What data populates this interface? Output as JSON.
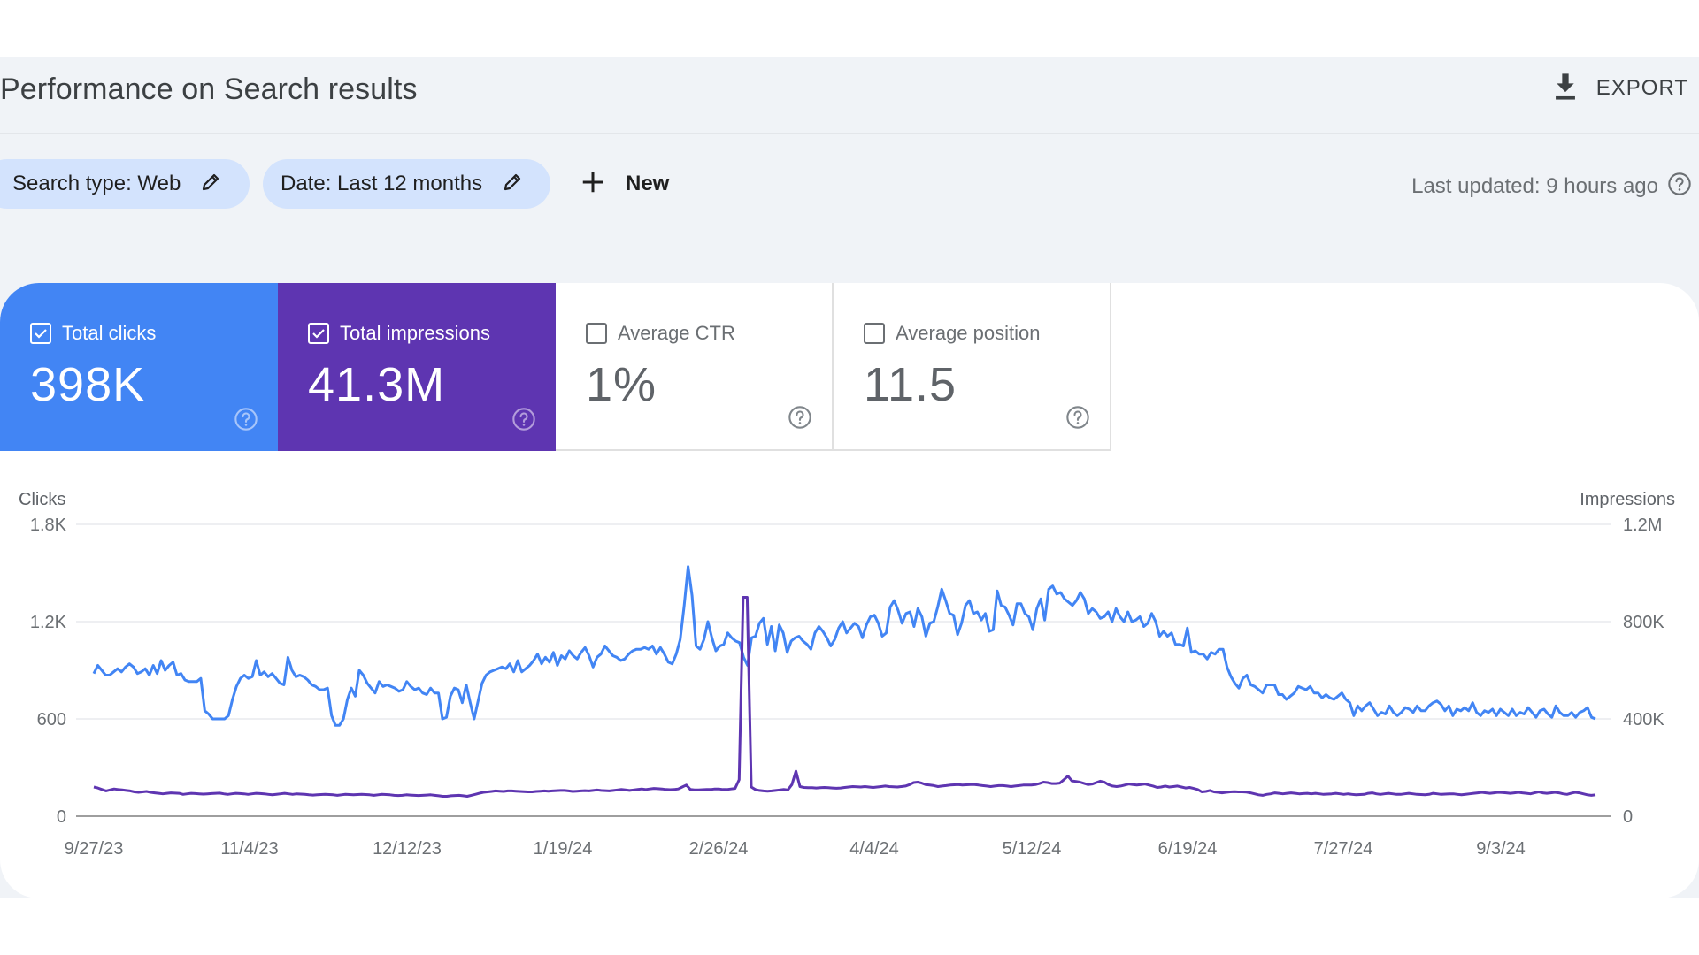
{
  "header": {
    "title": "Performance on Search results",
    "export_label": "EXPORT"
  },
  "filters": {
    "search_type": "Search type: Web",
    "date": "Date: Last 12 months",
    "new_label": "New",
    "last_updated": "Last updated: 9 hours ago"
  },
  "metrics": [
    {
      "label": "Total clicks",
      "value": "398K",
      "checked": true,
      "color": "#4285f4"
    },
    {
      "label": "Total impressions",
      "value": "41.3M",
      "checked": true,
      "color": "#5e35b1"
    },
    {
      "label": "Average CTR",
      "value": "1%",
      "checked": false
    },
    {
      "label": "Average position",
      "value": "11.5",
      "checked": false
    }
  ],
  "chart_data": {
    "type": "line",
    "title": "",
    "xlabel": "",
    "ylabel": "Clicks",
    "y2label": "Impressions",
    "ylim": [
      0,
      1800
    ],
    "y2lim": [
      0,
      1200000
    ],
    "yticks": [
      "0",
      "600",
      "1.2K",
      "1.8K"
    ],
    "y2ticks": [
      "0",
      "400K",
      "800K",
      "1.2M"
    ],
    "xtick_labels": [
      "9/27/23",
      "11/4/23",
      "12/12/23",
      "1/19/24",
      "2/26/24",
      "4/4/24",
      "5/12/24",
      "6/19/24",
      "7/27/24",
      "9/3/24"
    ],
    "grid": true,
    "legend": "none",
    "series": [
      {
        "name": "Clicks",
        "axis": "left",
        "color": "#4285f4",
        "values": [
          880,
          930,
          900,
          870,
          870,
          890,
          910,
          890,
          920,
          940,
          920,
          880,
          890,
          910,
          870,
          930,
          880,
          960,
          900,
          930,
          950,
          870,
          880,
          840,
          830,
          830,
          830,
          850,
          650,
          630,
          600,
          600,
          600,
          600,
          620,
          720,
          800,
          850,
          870,
          850,
          860,
          960,
          870,
          890,
          860,
          880,
          850,
          820,
          810,
          980,
          900,
          860,
          870,
          860,
          840,
          810,
          800,
          780,
          780,
          790,
          620,
          560,
          560,
          600,
          720,
          790,
          740,
          900,
          870,
          820,
          790,
          760,
          830,
          800,
          810,
          800,
          790,
          770,
          780,
          830,
          800,
          780,
          790,
          760,
          750,
          790,
          760,
          760,
          600,
          610,
          740,
          790,
          780,
          700,
          810,
          700,
          600,
          710,
          820,
          870,
          890,
          900,
          910,
          920,
          910,
          940,
          890,
          960,
          890,
          910,
          930,
          960,
          1000,
          940,
          980,
          950,
          1010,
          930,
          990,
          970,
          1020,
          990,
          970,
          1010,
          1040,
          990,
          920,
          980,
          1000,
          1050,
          1020,
          990,
          980,
          960,
          970,
          1000,
          1020,
          1030,
          1030,
          1040,
          1030,
          1050,
          1000,
          1040,
          1000,
          950,
          940,
          1000,
          1090,
          1300,
          1540,
          1360,
          1050,
          1030,
          1090,
          1200,
          1100,
          1020,
          1050,
          1060,
          1130,
          1100,
          1080,
          1070,
          980,
          930,
          1100,
          1110,
          1190,
          1220,
          1060,
          1170,
          1020,
          1180,
          1130,
          1010,
          1080,
          1100,
          1110,
          1080,
          1060,
          1030,
          1130,
          1170,
          1140,
          1100,
          1050,
          1090,
          1160,
          1200,
          1130,
          1160,
          1190,
          1170,
          1100,
          1180,
          1230,
          1240,
          1190,
          1110,
          1130,
          1290,
          1330,
          1270,
          1190,
          1250,
          1260,
          1170,
          1280,
          1230,
          1110,
          1190,
          1200,
          1290,
          1400,
          1330,
          1250,
          1240,
          1120,
          1190,
          1300,
          1330,
          1250,
          1260,
          1210,
          1250,
          1140,
          1150,
          1390,
          1300,
          1290,
          1240,
          1180,
          1310,
          1310,
          1250,
          1230,
          1150,
          1280,
          1340,
          1210,
          1400,
          1420,
          1370,
          1380,
          1340,
          1320,
          1300,
          1330,
          1380,
          1340,
          1250,
          1280,
          1260,
          1220,
          1230,
          1260,
          1200,
          1280,
          1230,
          1200,
          1260,
          1200,
          1210,
          1230,
          1170,
          1190,
          1250,
          1200,
          1110,
          1140,
          1110,
          1130,
          1060,
          1060,
          1050,
          1160,
          1010,
          1020,
          1000,
          1000,
          970,
          1010,
          1000,
          1030,
          1030,
          920,
          860,
          820,
          790,
          850,
          870,
          810,
          800,
          780,
          760,
          810,
          810,
          810,
          750,
          750,
          720,
          740,
          760,
          800,
          790,
          780,
          800,
          760,
          760,
          730,
          750,
          730,
          720,
          740,
          760,
          720,
          700,
          620,
          680,
          650,
          680,
          700,
          660,
          620,
          640,
          630,
          680,
          640,
          620,
          640,
          670,
          660,
          640,
          680,
          650,
          650,
          680,
          700,
          710,
          690,
          650,
          680,
          620,
          660,
          650,
          670,
          650,
          700,
          640,
          620,
          650,
          640,
          660,
          620,
          660,
          640,
          620,
          660,
          620,
          640,
          630,
          670,
          640,
          610,
          650,
          660,
          630,
          610,
          680,
          640,
          620,
          620,
          640,
          610,
          640,
          650,
          670,
          610,
          600
        ],
        "sample_note": "approximate daily values read from chart"
      },
      {
        "name": "Impressions",
        "axis": "right",
        "color": "#5e35b1",
        "values": [
          120000,
          116000,
          110000,
          104000,
          108000,
          112000,
          110000,
          108000,
          106000,
          104000,
          100000,
          98000,
          100000,
          102000,
          98000,
          96000,
          94000,
          92000,
          94000,
          96000,
          95000,
          94000,
          90000,
          92000,
          94000,
          93000,
          92000,
          91000,
          92000,
          93000,
          94000,
          95000,
          92000,
          90000,
          92000,
          94000,
          93000,
          92000,
          90000,
          92000,
          94000,
          93000,
          92000,
          90000,
          88000,
          90000,
          92000,
          94000,
          92000,
          90000,
          92000,
          91000,
          90000,
          88000,
          87000,
          88000,
          89000,
          90000,
          89000,
          88000,
          86000,
          88000,
          90000,
          89000,
          88000,
          89000,
          90000,
          89000,
          88000,
          86000,
          88000,
          90000,
          89000,
          88000,
          86000,
          85000,
          86000,
          88000,
          87000,
          86000,
          85000,
          86000,
          87000,
          88000,
          86000,
          84000,
          82000,
          82000,
          84000,
          85000,
          86000,
          84000,
          82000,
          86000,
          90000,
          94000,
          98000,
          100000,
          102000,
          104000,
          103000,
          102000,
          104000,
          104000,
          103000,
          102000,
          101000,
          100000,
          100000,
          102000,
          103000,
          104000,
          103000,
          104000,
          105000,
          106000,
          106000,
          104000,
          102000,
          103000,
          104000,
          105000,
          104000,
          106000,
          108000,
          106000,
          105000,
          104000,
          106000,
          108000,
          110000,
          108000,
          106000,
          108000,
          110000,
          112000,
          110000,
          112000,
          114000,
          113000,
          112000,
          110000,
          109000,
          110000,
          112000,
          120000,
          128000,
          110000,
          108000,
          108000,
          109000,
          110000,
          110000,
          112000,
          112000,
          110000,
          110000,
          112000,
          114000,
          150000,
          900000,
          900000,
          120000,
          110000,
          106000,
          104000,
          103000,
          104000,
          106000,
          108000,
          110000,
          108000,
          130000,
          185000,
          122000,
          118000,
          117000,
          117000,
          116000,
          117000,
          118000,
          117000,
          116000,
          115000,
          116000,
          118000,
          120000,
          122000,
          121000,
          120000,
          122000,
          120000,
          118000,
          120000,
          122000,
          124000,
          122000,
          121000,
          120000,
          122000,
          124000,
          130000,
          138000,
          140000,
          136000,
          130000,
          128000,
          126000,
          122000,
          124000,
          126000,
          128000,
          129000,
          130000,
          128000,
          129000,
          130000,
          130000,
          128000,
          126000,
          124000,
          122000,
          124000,
          126000,
          126000,
          124000,
          122000,
          124000,
          126000,
          128000,
          128000,
          128000,
          130000,
          134000,
          140000,
          138000,
          134000,
          134000,
          136000,
          150000,
          165000,
          145000,
          143000,
          140000,
          135000,
          130000,
          132000,
          138000,
          144000,
          140000,
          130000,
          124000,
          122000,
          124000,
          128000,
          132000,
          130000,
          128000,
          130000,
          132000,
          128000,
          124000,
          118000,
          120000,
          124000,
          120000,
          122000,
          124000,
          120000,
          116000,
          118000,
          114000,
          110000,
          100000,
          102000,
          106000,
          100000,
          98000,
          96000,
          98000,
          100000,
          101000,
          100000,
          100000,
          99000,
          96000,
          92000,
          88000,
          86000,
          90000,
          92000,
          96000,
          94000,
          92000,
          94000,
          96000,
          94000,
          92000,
          93000,
          94000,
          92000,
          94000,
          92000,
          90000,
          91000,
          92000,
          94000,
          92000,
          90000,
          92000,
          90000,
          88000,
          89000,
          90000,
          94000,
          96000,
          92000,
          90000,
          92000,
          94000,
          92000,
          90000,
          90000,
          92000,
          94000,
          92000,
          90000,
          89000,
          88000,
          90000,
          94000,
          92000,
          90000,
          91000,
          92000,
          92000,
          90000,
          88000,
          90000,
          92000,
          94000,
          96000,
          98000,
          96000,
          94000,
          96000,
          98000,
          97000,
          96000,
          94000,
          96000,
          98000,
          96000,
          94000,
          92000,
          96000,
          100000,
          96000,
          94000,
          96000,
          98000,
          96000,
          92000,
          90000,
          94000,
          98000,
          96000,
          92000,
          88000,
          86000,
          88000
        ],
        "sample_note": "approximate daily values read from chart"
      }
    ]
  }
}
